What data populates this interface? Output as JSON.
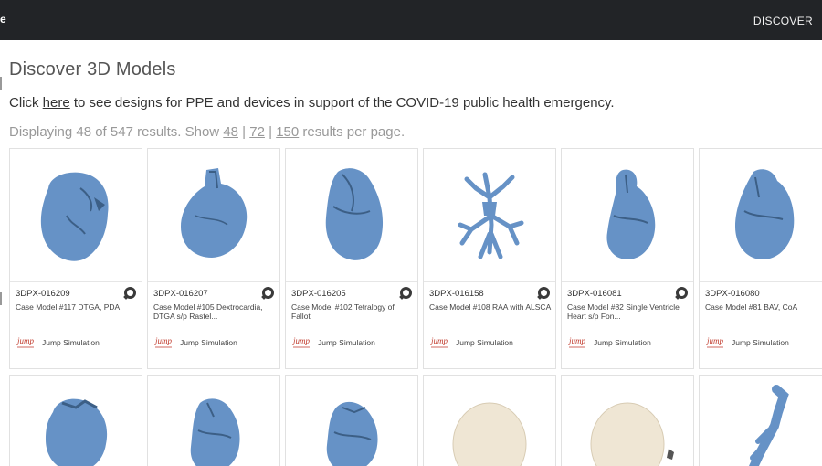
{
  "topbar": {
    "logo": "e",
    "discover": "DISCOVER"
  },
  "page": {
    "title": "Discover 3D Models",
    "notice_prefix": "Click",
    "notice_link": "here",
    "notice_suffix": "to see designs for PPE and devices in support of the COVID-19 public health emergency.",
    "results_prefix": "Displaying 48 of 547 results. Show",
    "per_page": [
      "48",
      "72",
      "150"
    ],
    "separator": "|",
    "results_suffix": "results per page."
  },
  "colors": {
    "model_blue": "#5f8fc3",
    "model_beige": "#efe6d4",
    "brand_red": "#c0392b",
    "topbar": "#222427"
  },
  "cards_row1": [
    {
      "code": "3DPX-016209",
      "name": "Case Model #117 DTGA, PDA",
      "author": "Jump Simulation",
      "has_comment_icon": true
    },
    {
      "code": "3DPX-016207",
      "name": "Case Model #105 Dextrocardia, DTGA s/p Rastel...",
      "author": "Jump Simulation",
      "has_comment_icon": true
    },
    {
      "code": "3DPX-016205",
      "name": "Case Model #102 Tetralogy of Fallot",
      "author": "Jump Simulation",
      "has_comment_icon": true
    },
    {
      "code": "3DPX-016158",
      "name": "Case Model #108 RAA with ALSCA",
      "author": "Jump Simulation",
      "has_comment_icon": true
    },
    {
      "code": "3DPX-016081",
      "name": "Case Model #82 Single Ventricle Heart s/p Fon...",
      "author": "Jump Simulation",
      "has_comment_icon": true
    },
    {
      "code": "3DPX-016080",
      "name": "Case Model #81 BAV, CoA",
      "author": "Jump Simulation",
      "has_comment_icon": false
    }
  ],
  "author_logo_text": "jump"
}
